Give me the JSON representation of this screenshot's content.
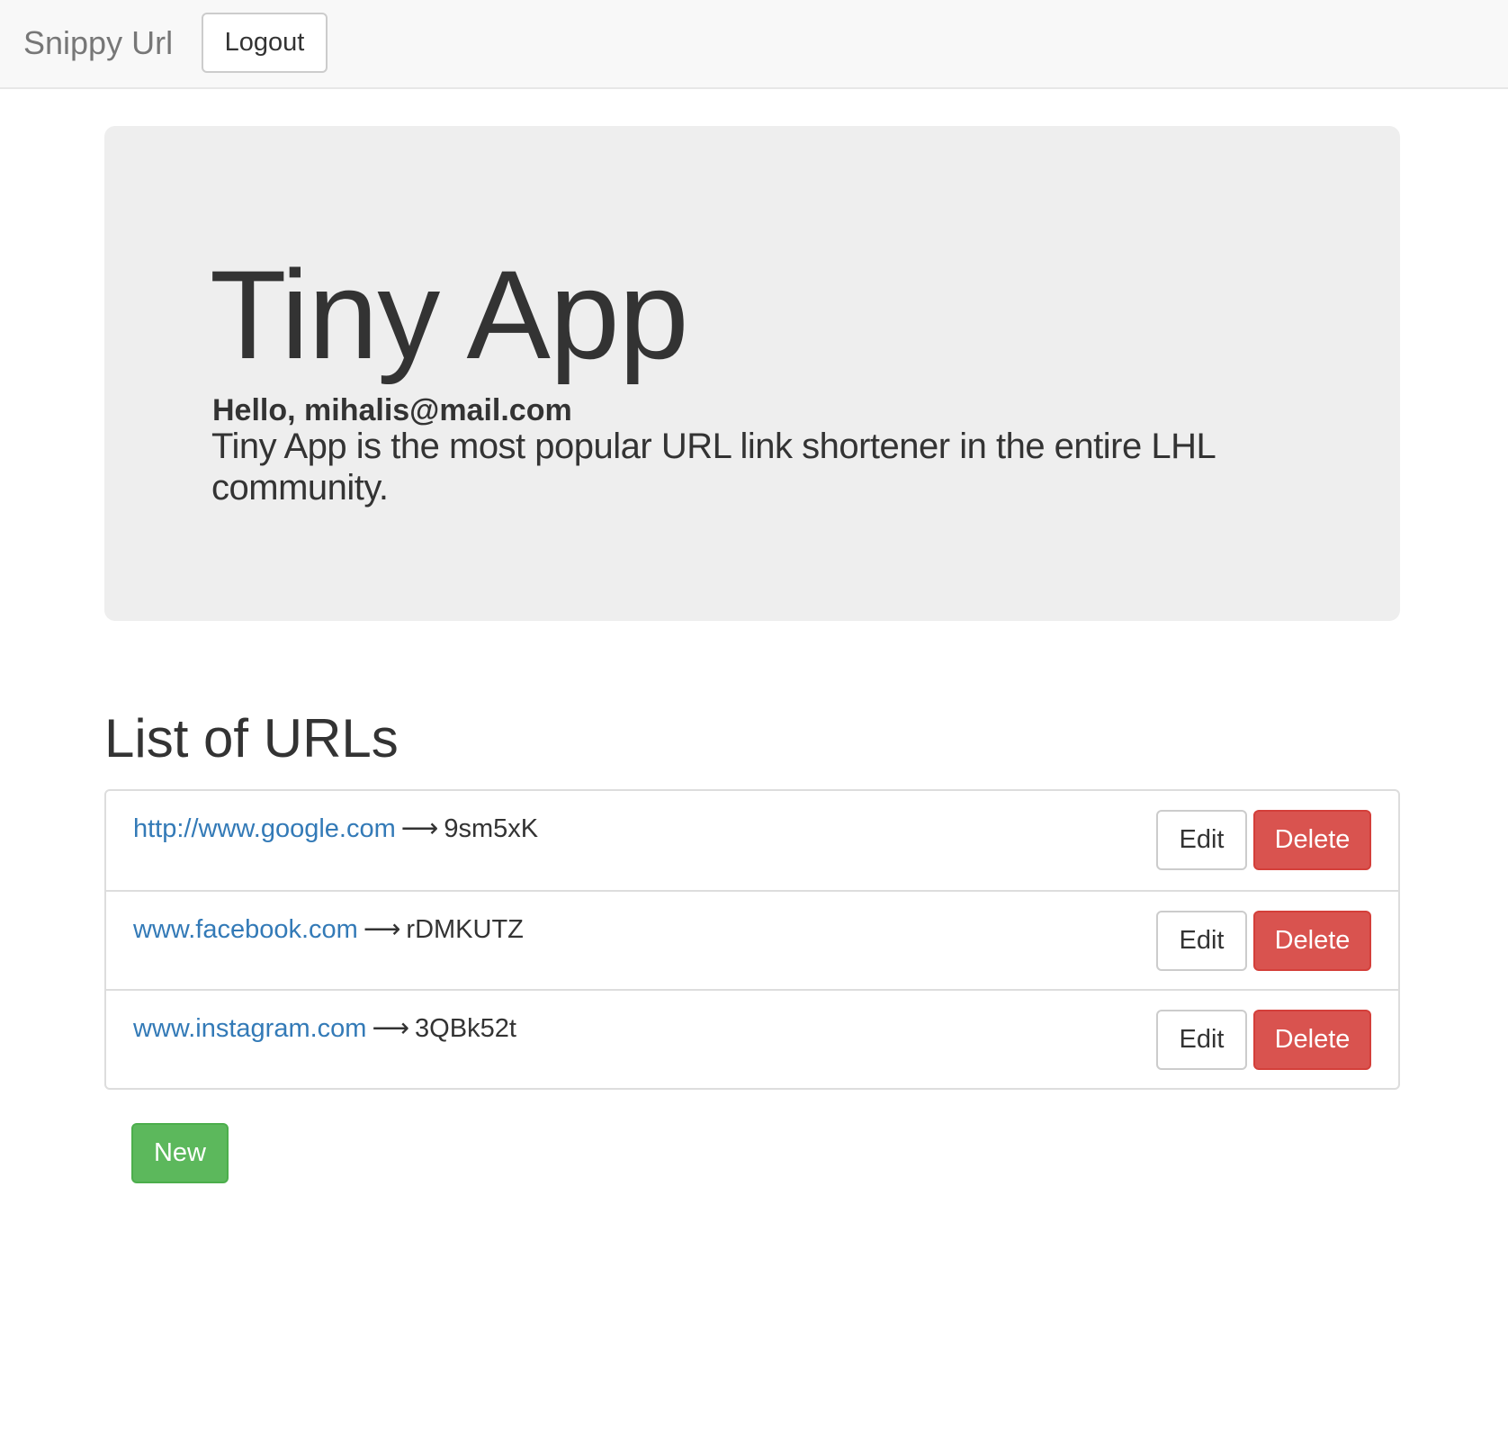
{
  "navbar": {
    "brand": "Snippy Url",
    "logout_label": "Logout"
  },
  "jumbotron": {
    "title": "Tiny App",
    "greeting": "Hello, mihalis@mail.com",
    "tagline": "Tiny App is the most popular URL link shortener in the entire LHL community."
  },
  "list": {
    "title": "List of URLs",
    "arrow": "⟶",
    "edit_label": "Edit",
    "delete_label": "Delete",
    "items": [
      {
        "long_url": "http://www.google.com",
        "short_code": "9sm5xK"
      },
      {
        "long_url": "www.facebook.com",
        "short_code": "rDMKUTZ"
      },
      {
        "long_url": "www.instagram.com",
        "short_code": "3QBk52t"
      }
    ]
  },
  "new_label": "New",
  "colors": {
    "link": "#337ab7",
    "danger": "#d9534f",
    "success": "#5cb85c",
    "jumbotron_bg": "#eeeeee",
    "navbar_bg": "#f8f8f8"
  }
}
